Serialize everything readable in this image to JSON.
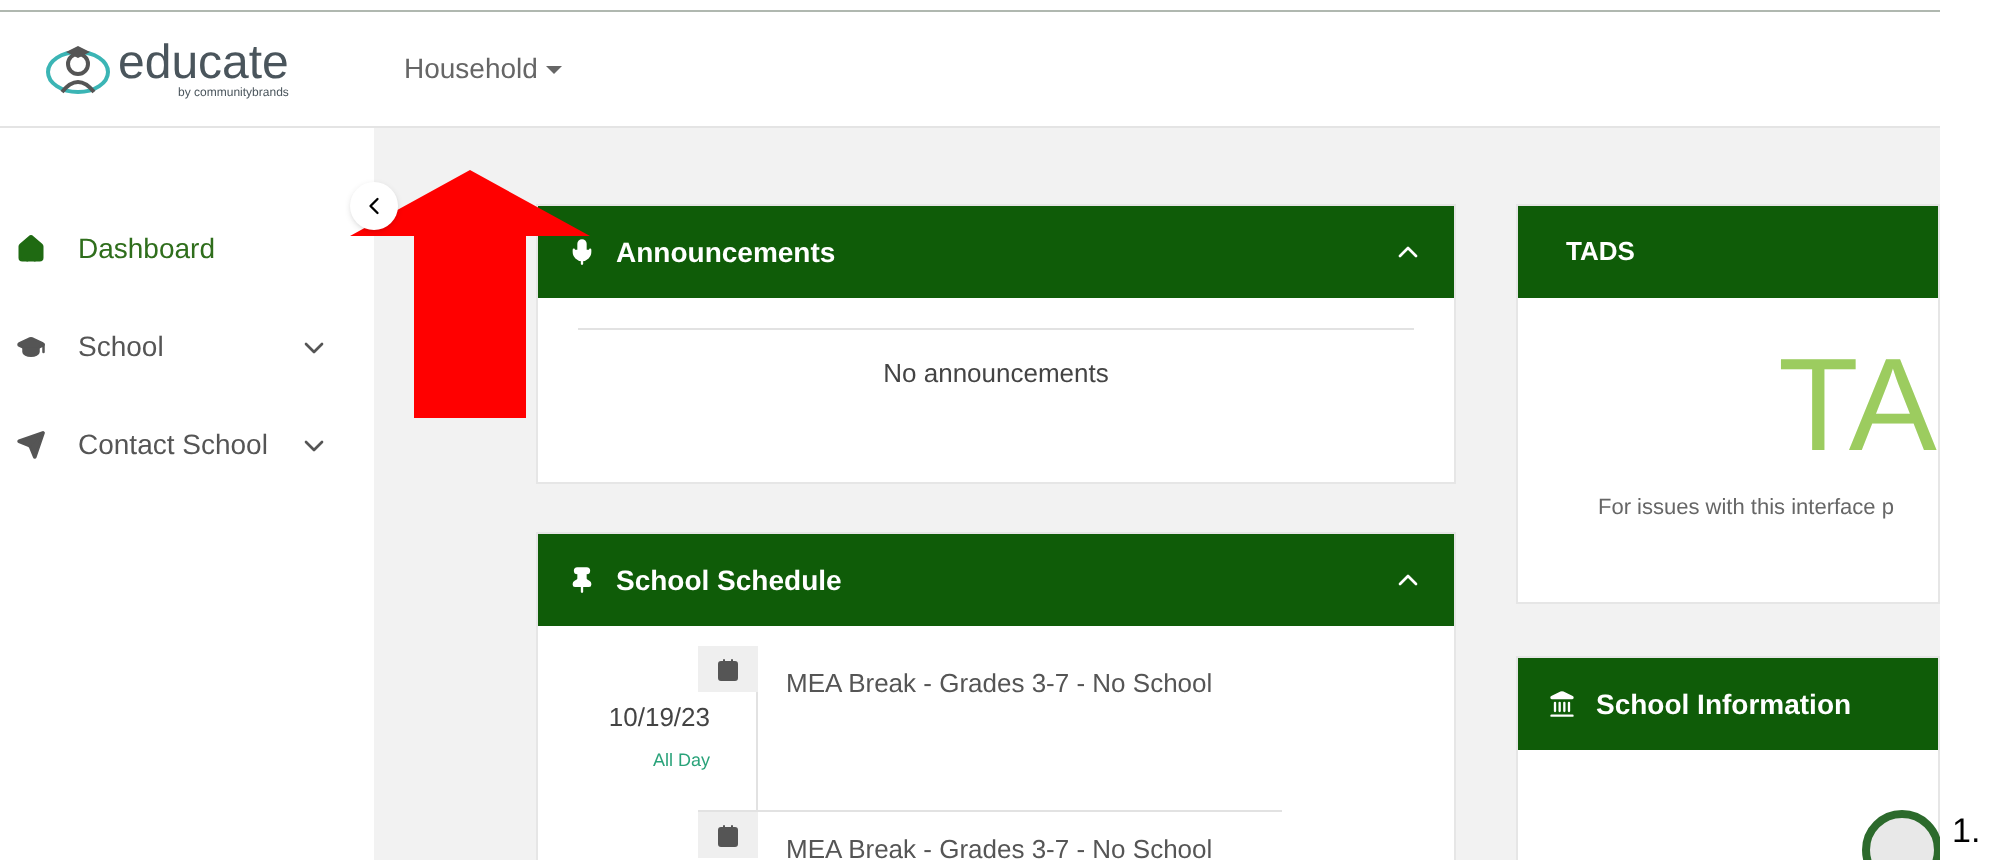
{
  "header": {
    "brand": {
      "name": "educate",
      "tagline": "by communitybrands"
    },
    "menu": "Household"
  },
  "sidebar": {
    "items": [
      {
        "label": "Dashboard",
        "selected": true,
        "expandable": false
      },
      {
        "label": "School",
        "selected": false,
        "expandable": true
      },
      {
        "label": "Contact School",
        "selected": false,
        "expandable": true
      }
    ]
  },
  "announcements": {
    "title": "Announcements",
    "empty_text": "No announcements"
  },
  "schedule": {
    "title": "School Schedule",
    "events": [
      {
        "date": "10/19/23",
        "time": "All Day",
        "title": "MEA Break - Grades 3-7 - No School"
      },
      {
        "title": "MEA Break - Grades 3-7 - No School"
      }
    ]
  },
  "tads": {
    "title": "TADS",
    "logo_text": "TA",
    "note": "For issues with this interface p"
  },
  "school_info": {
    "title": "School Information"
  },
  "annotation": {
    "label": "1."
  }
}
